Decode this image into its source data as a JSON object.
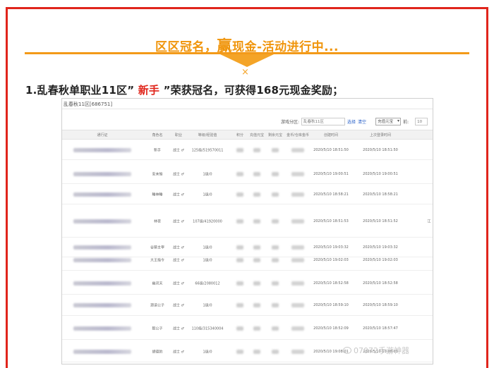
{
  "banner": {
    "part1": "区区冠名，",
    "big": "赢",
    "part2": "现金-活动进行中..."
  },
  "headline": {
    "prefix": "1.乱春秋单职业11区”",
    "highlight": "新手",
    "suffix": "”荣获冠名，可获得168元现金奖励；"
  },
  "screenshot": {
    "title": "乱春秋11区[686751]",
    "filter": {
      "label": "游戏分区:",
      "input_value": "乱春秋11区",
      "search_link": "选择",
      "clear_link": "清空",
      "select_value": "充值元宝",
      "num_label": "前:",
      "num_value": "10"
    },
    "columns": [
      "通行证",
      "角色名",
      "职业",
      "等级/经验值",
      "积分",
      "充值元宝",
      "剩余元宝",
      "金币/仓库金币",
      "创建时间",
      "上次登录时间"
    ],
    "rows": [
      {
        "name": "新手",
        "job": "战士 ♂",
        "level": "125级/519570011",
        "created": "2020/5/10 18:51:50",
        "last": "2020/5/10 18:51:50",
        "extra": ""
      },
      {
        "name": "安未愉",
        "job": "战士 ♂",
        "level": "1级/0",
        "created": "2020/5/10 19:00:51",
        "last": "2020/5/10 19:00:51",
        "extra": ""
      },
      {
        "name": "睡神睡",
        "job": "战士 ♂",
        "level": "1级/0",
        "created": "2020/5/10 18:58:21",
        "last": "2020/5/10 18:58:21",
        "extra": ""
      },
      {
        "name": "林夜",
        "job": "战士 ♂",
        "level": "107级/41920000",
        "created": "2020/5/10 18:51:53",
        "last": "2020/5/10 18:51:52",
        "extra": "江"
      },
      {
        "name": "谷葵主宰",
        "job": "战士 ♂",
        "level": "1级/0",
        "created": "2020/5/10 19:03:32",
        "last": "2020/5/10 19:03:32",
        "extra": ""
      },
      {
        "name": "大王指令",
        "job": "战士 ♂",
        "level": "1级/0",
        "created": "2020/5/10 19:02:03",
        "last": "2020/5/10 19:02:03",
        "extra": ""
      },
      {
        "name": "幽灵天",
        "job": "战士 ♂",
        "level": "66级/2080012",
        "created": "2020/5/10 18:52:58",
        "last": "2020/5/10 18:52:58",
        "extra": ""
      },
      {
        "name": "源道公子",
        "job": "战士 ♂",
        "level": "1级/0",
        "created": "2020/5/10 18:59:10",
        "last": "2020/5/10 18:59:10",
        "extra": ""
      },
      {
        "name": "毅公子",
        "job": "战士 ♂",
        "level": "110级/315340004",
        "created": "2020/5/10 18:52:09",
        "last": "2020/5/10 18:57:47",
        "extra": ""
      },
      {
        "name": "胡德豹",
        "job": "战士 ♂",
        "level": "1级/0",
        "created": "2020/5/10 19:08:01",
        "last": "2020/5/10 19:08:01",
        "extra": ""
      }
    ]
  },
  "watermark": "07072手游神器",
  "colors": {
    "frame_red": "#e0251b",
    "banner_orange": "#f0950c",
    "headline_red": "#e0251b"
  }
}
